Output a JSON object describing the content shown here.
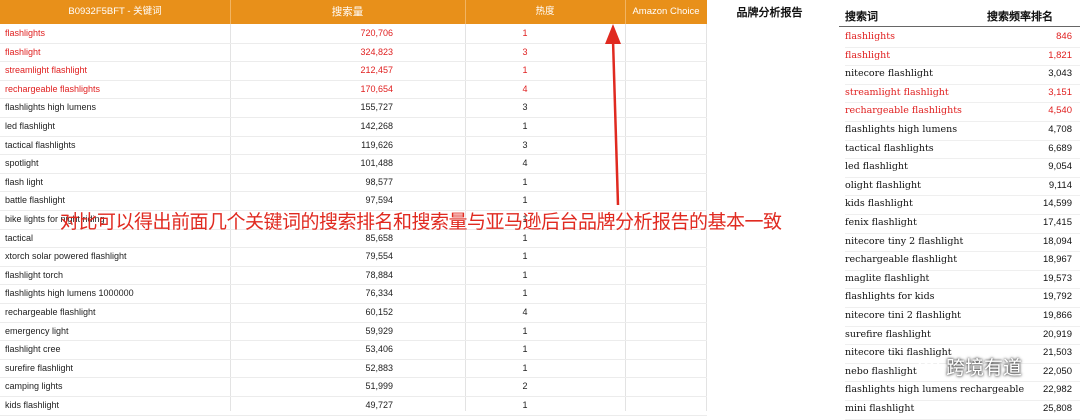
{
  "left_table": {
    "headers": [
      "B0932F5BFT - 关键词",
      "搜索量",
      "热度",
      "Amazon Choice"
    ],
    "rows": [
      {
        "keyword": "flashlights",
        "volume": "720,706",
        "heat": "1",
        "red": true
      },
      {
        "keyword": "flashlight",
        "volume": "324,823",
        "heat": "3",
        "red": true
      },
      {
        "keyword": "streamlight flashlight",
        "volume": "212,457",
        "heat": "1",
        "red": true
      },
      {
        "keyword": "rechargeable flashlights",
        "volume": "170,654",
        "heat": "4",
        "red": true
      },
      {
        "keyword": "flashlights high lumens",
        "volume": "155,727",
        "heat": "3",
        "red": false
      },
      {
        "keyword": "led flashlight",
        "volume": "142,268",
        "heat": "1",
        "red": false
      },
      {
        "keyword": "tactical flashlights",
        "volume": "119,626",
        "heat": "3",
        "red": false
      },
      {
        "keyword": "spotlight",
        "volume": "101,488",
        "heat": "4",
        "red": false
      },
      {
        "keyword": "flash light",
        "volume": "98,577",
        "heat": "1",
        "red": false
      },
      {
        "keyword": "battle flashlight",
        "volume": "97,594",
        "heat": "1",
        "red": false
      },
      {
        "keyword": "bike lights for night riding",
        "volume": "",
        "heat": "1",
        "red": false
      },
      {
        "keyword": "tactical",
        "volume": "85,658",
        "heat": "1",
        "red": false
      },
      {
        "keyword": "xtorch solar powered flashlight",
        "volume": "79,554",
        "heat": "1",
        "red": false
      },
      {
        "keyword": "flashlight torch",
        "volume": "78,884",
        "heat": "1",
        "red": false
      },
      {
        "keyword": "flashlights high lumens 1000000",
        "volume": "76,334",
        "heat": "1",
        "red": false
      },
      {
        "keyword": "rechargeable flashlight",
        "volume": "60,152",
        "heat": "4",
        "red": false
      },
      {
        "keyword": "emergency light",
        "volume": "59,929",
        "heat": "1",
        "red": false
      },
      {
        "keyword": "flashlight cree",
        "volume": "53,406",
        "heat": "1",
        "red": false
      },
      {
        "keyword": "surefire flashlight",
        "volume": "52,883",
        "heat": "1",
        "red": false
      },
      {
        "keyword": "camping lights",
        "volume": "51,999",
        "heat": "2",
        "red": false
      },
      {
        "keyword": "kids flashlight",
        "volume": "49,727",
        "heat": "1",
        "red": false
      }
    ]
  },
  "right_table": {
    "title": "品牌分析报告",
    "headers": [
      "搜索词",
      "搜索频率排名"
    ],
    "rows": [
      {
        "keyword": "flashlights",
        "rank": "846",
        "red": true
      },
      {
        "keyword": "flashlight",
        "rank": "1,821",
        "red": true
      },
      {
        "keyword": "nitecore flashlight",
        "rank": "3,043",
        "red": false
      },
      {
        "keyword": "streamlight flashlight",
        "rank": "3,151",
        "red": true
      },
      {
        "keyword": "rechargeable flashlights",
        "rank": "4,540",
        "red": true
      },
      {
        "keyword": "flashlights high lumens",
        "rank": "4,708",
        "red": false
      },
      {
        "keyword": "tactical flashlights",
        "rank": "6,689",
        "red": false
      },
      {
        "keyword": "led flashlight",
        "rank": "9,054",
        "red": false
      },
      {
        "keyword": "olight flashlight",
        "rank": "9,114",
        "red": false
      },
      {
        "keyword": "kids flashlight",
        "rank": "14,599",
        "red": false
      },
      {
        "keyword": "fenix flashlight",
        "rank": "17,415",
        "red": false
      },
      {
        "keyword": "nitecore tiny 2 flashlight",
        "rank": "18,094",
        "red": false
      },
      {
        "keyword": "rechargeable flashlight",
        "rank": "18,967",
        "red": false
      },
      {
        "keyword": "maglite flashlight",
        "rank": "19,573",
        "red": false
      },
      {
        "keyword": "flashlights for kids",
        "rank": "19,792",
        "red": false
      },
      {
        "keyword": "nitecore tini 2 flashlight",
        "rank": "19,866",
        "red": false
      },
      {
        "keyword": "surefire flashlight",
        "rank": "20,919",
        "red": false
      },
      {
        "keyword": "nitecore tiki flashlight",
        "rank": "21,503",
        "red": false
      },
      {
        "keyword": "nebo flashlight",
        "rank": "22,050",
        "red": false
      },
      {
        "keyword": "flashlights high lumens rechargeable",
        "rank": "22,982",
        "red": false
      },
      {
        "keyword": "mini flashlight",
        "rank": "25,808",
        "red": false
      }
    ]
  },
  "annotation": {
    "text": "对比可以得出前面几个关键词的搜索排名和搜索量与亚马逊后台品牌分析报告的基本一致",
    "color": "#e02a20"
  },
  "watermark": {
    "text": "跨境有道",
    "icon": "wechat-official-account-icon"
  },
  "colors": {
    "header_bg": "#e8901a",
    "highlight_red": "#e02020"
  }
}
